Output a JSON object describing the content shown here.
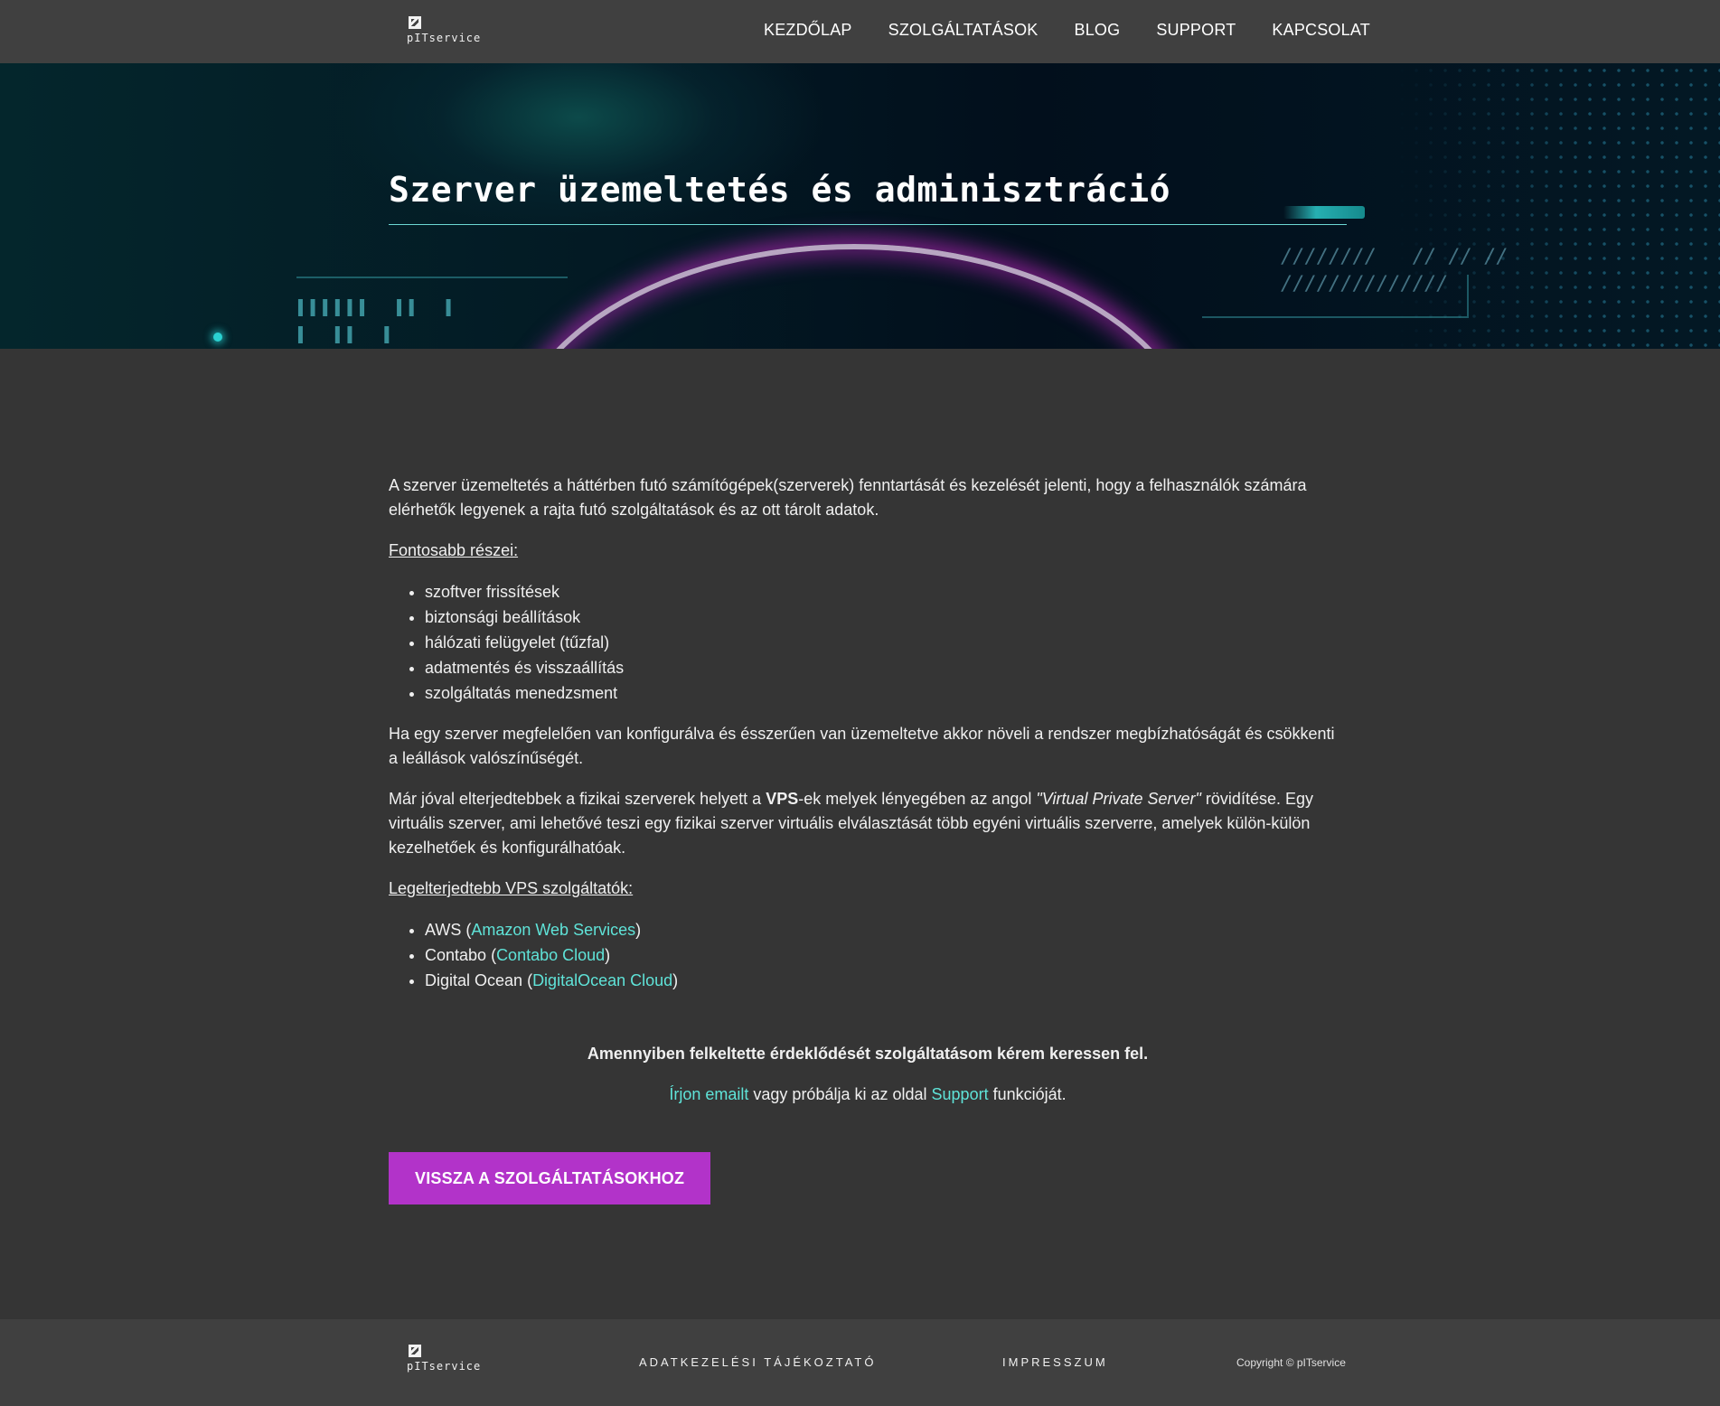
{
  "header": {
    "logo_text": "pITservice",
    "nav": [
      "KEZDŐLAP",
      "SZOLGÁLTATÁSOK",
      "BLOG",
      "SUPPORT",
      "KAPCSOLAT"
    ]
  },
  "hero": {
    "title": "Szerver üzemeltetés és adminisztráció"
  },
  "content": {
    "intro": "A szerver üzemeltetés a háttérben futó számítógépek(szerverek) fenntartását és kezelését jelenti, hogy a felhasználók számára elérhetők legyenek a rajta futó szolgáltatások és az ott tárolt adatok.",
    "parts_heading": "Fontosabb részei:",
    "parts": [
      "szoftver frissítések",
      "biztonsági beállítások",
      "hálózati felügyelet (tűzfal)",
      "adatmentés és visszaállítás",
      "szolgáltatás menedzsment"
    ],
    "config_text": "Ha egy szerver megfelelően van konfigurálva és ésszerűen van üzemeltetve akkor növeli a rendszer megbízhatóságát és csökkenti a leállások valószínűségét.",
    "vps_before": "Már jóval elterjedtebbek a fizikai szerverek helyett a ",
    "vps_bold": "VPS",
    "vps_middle": "-ek melyek lényegében az angol ",
    "vps_italic": "\"Virtual Private Server\"",
    "vps_after": " rövidítése. Egy virtuális szerver, ami lehetővé teszi egy fizikai szerver virtuális elválasztását több egyéni virtuális szerverre, amelyek külön-külön kezelhetőek és konfigurálhatóak.",
    "providers_heading": "Legelterjedtebb VPS szolgáltatók:",
    "providers": [
      {
        "name": "AWS",
        "link": "Amazon Web Services"
      },
      {
        "name": "Contabo",
        "link": "Contabo Cloud"
      },
      {
        "name": "Digital Ocean",
        "link": "DigitalOcean Cloud"
      }
    ],
    "cta_strong": "Amennyiben felkeltette érdeklődését szolgáltatásom kérem keressen fel.",
    "cta_email_link": "Írjon emailt",
    "cta_middle": " vagy próbálja ki az oldal ",
    "cta_support_link": "Support",
    "cta_end": " funkcióját.",
    "back_button": "VISSZA A SZOLGÁLTATÁSOKHOZ"
  },
  "footer": {
    "logo_text": "pITservice",
    "privacy": "ADATKEZELÉSI TÁJÉKOZTATÓ",
    "imprint": "IMPRESSZUM",
    "copyright": "Copyright © pITservice"
  },
  "colors": {
    "accent_link": "#5fe3d8",
    "button": "#b233c9",
    "background": "#353535",
    "header": "#404040"
  }
}
